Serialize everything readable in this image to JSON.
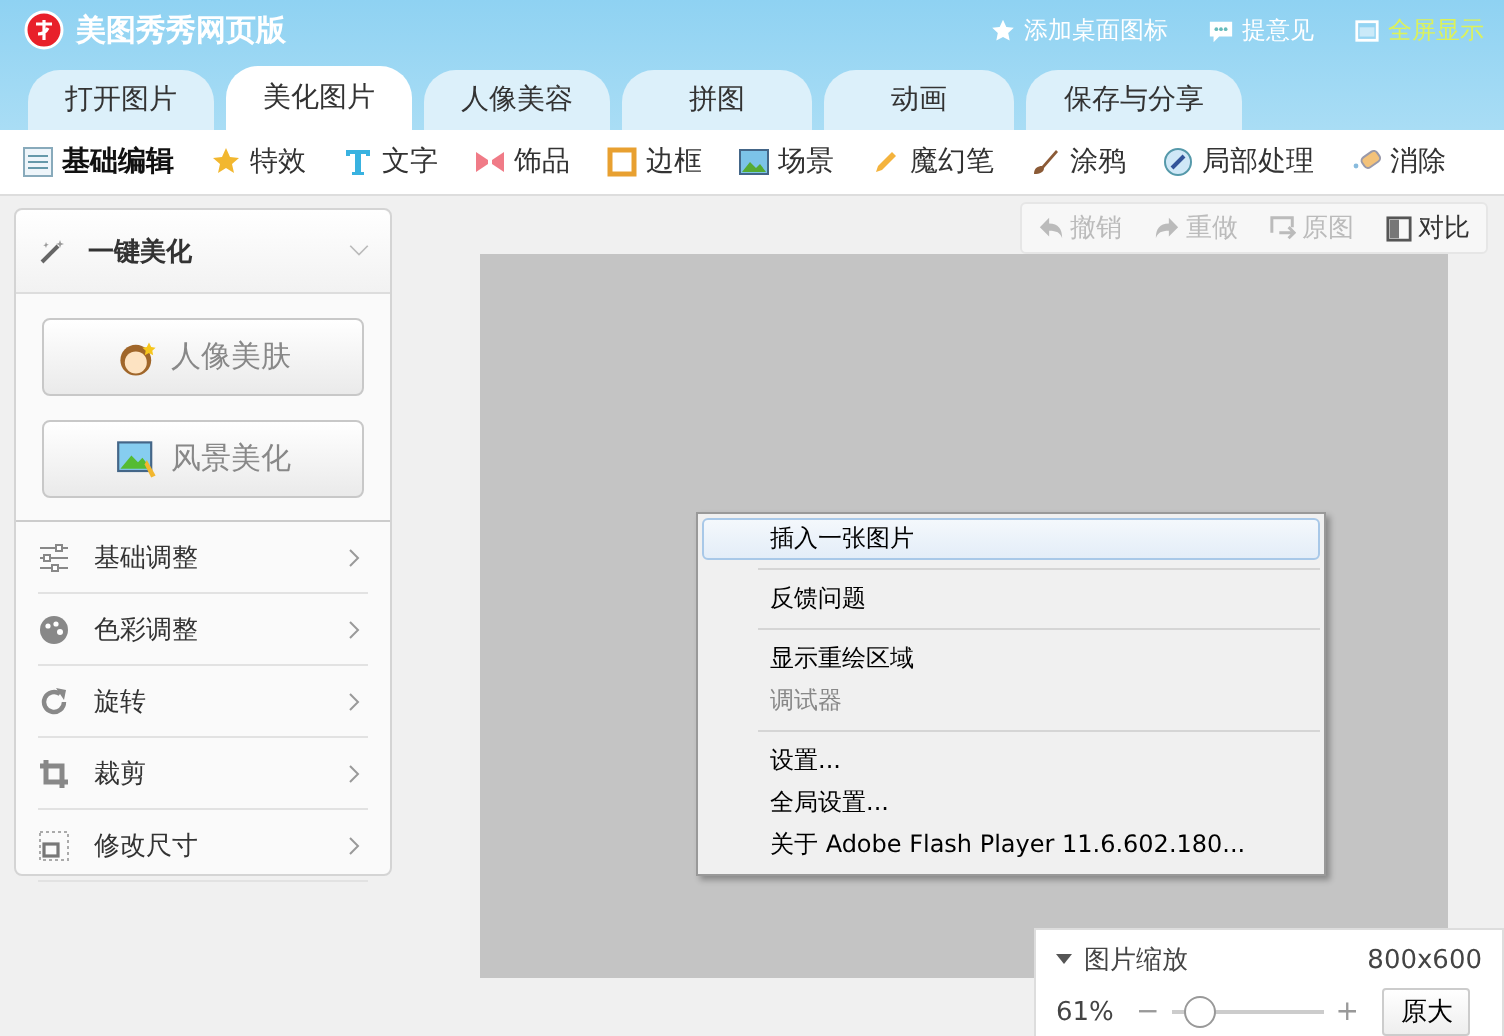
{
  "window": {
    "title": "美图秀秀网页版"
  },
  "header_links": [
    {
      "label": "添加桌面图标",
      "kind": "star"
    },
    {
      "label": "提意见",
      "kind": "comment"
    },
    {
      "label": "全屏显示",
      "kind": "fullscreen"
    }
  ],
  "tabs": [
    {
      "label": "打开图片",
      "selected": false
    },
    {
      "label": "美化图片",
      "selected": true
    },
    {
      "label": "人像美容",
      "selected": false
    },
    {
      "label": "拼图",
      "selected": false
    },
    {
      "label": "动画",
      "selected": false
    },
    {
      "label": "保存与分享",
      "selected": false
    }
  ],
  "tools": [
    {
      "label": "基础编辑",
      "kind": "sliders",
      "selected": true
    },
    {
      "label": "特效",
      "kind": "star",
      "selected": false
    },
    {
      "label": "文字",
      "kind": "text",
      "selected": false
    },
    {
      "label": "饰品",
      "kind": "bow",
      "selected": false
    },
    {
      "label": "边框",
      "kind": "frame",
      "selected": false
    },
    {
      "label": "场景",
      "kind": "picture",
      "selected": false
    },
    {
      "label": "魔幻笔",
      "kind": "pen",
      "selected": false
    },
    {
      "label": "涂鸦",
      "kind": "brush",
      "selected": false
    },
    {
      "label": "局部处理",
      "kind": "drop",
      "selected": false
    },
    {
      "label": "消除",
      "kind": "eraser",
      "selected": false
    }
  ],
  "side_panel": {
    "header": "一键美化",
    "buttons": [
      {
        "label": "人像美肤",
        "kind": "portrait"
      },
      {
        "label": "风景美化",
        "kind": "landscape"
      }
    ],
    "items": [
      {
        "label": "基础调整",
        "kind": "sliders"
      },
      {
        "label": "色彩调整",
        "kind": "palette"
      },
      {
        "label": "旋转",
        "kind": "rotate"
      },
      {
        "label": "裁剪",
        "kind": "crop"
      },
      {
        "label": "修改尺寸",
        "kind": "resize"
      }
    ]
  },
  "edit_actions": [
    {
      "label": "撤销",
      "kind": "undo",
      "disabled": true
    },
    {
      "label": "重做",
      "kind": "redo",
      "disabled": true
    },
    {
      "label": "原图",
      "kind": "original",
      "disabled": true
    },
    {
      "label": "对比",
      "kind": "compare",
      "disabled": false
    }
  ],
  "context_menu": [
    {
      "kind": "item",
      "label": "插入一张图片",
      "selected": true,
      "disabled": false
    },
    {
      "kind": "separator"
    },
    {
      "kind": "item",
      "label": "反馈问题",
      "selected": false,
      "disabled": false
    },
    {
      "kind": "separator"
    },
    {
      "kind": "item",
      "label": "显示重绘区域",
      "selected": false,
      "disabled": false
    },
    {
      "kind": "item",
      "label": "调试器",
      "selected": false,
      "disabled": true
    },
    {
      "kind": "separator"
    },
    {
      "kind": "item",
      "label": "设置...",
      "selected": false,
      "disabled": false
    },
    {
      "kind": "item",
      "label": "全局设置...",
      "selected": false,
      "disabled": false
    },
    {
      "kind": "item",
      "label": "关于 Adobe Flash Player 11.6.602.180...",
      "selected": false,
      "disabled": false
    }
  ],
  "zoom_panel": {
    "title": "图片缩放",
    "size": "800x600",
    "percent": "61%",
    "minus": "−",
    "plus": "+",
    "level": 0.1,
    "reset_button": "原大"
  }
}
